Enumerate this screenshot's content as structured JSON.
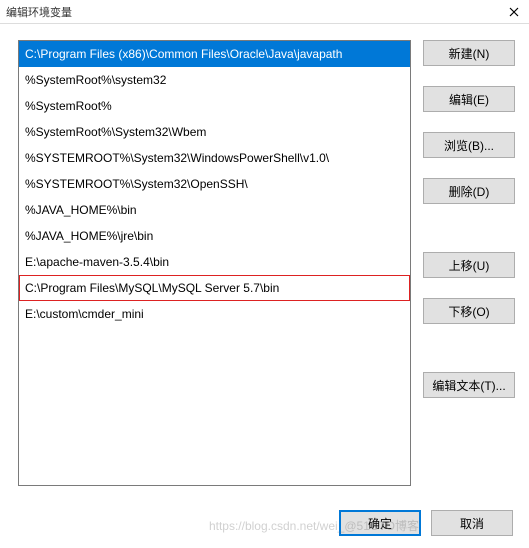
{
  "titlebar": {
    "title": "编辑环境变量"
  },
  "list": {
    "items": [
      {
        "text": "C:\\Program Files (x86)\\Common Files\\Oracle\\Java\\javapath",
        "selected": true,
        "highlighted": false
      },
      {
        "text": "%SystemRoot%\\system32",
        "selected": false,
        "highlighted": false
      },
      {
        "text": "%SystemRoot%",
        "selected": false,
        "highlighted": false
      },
      {
        "text": "%SystemRoot%\\System32\\Wbem",
        "selected": false,
        "highlighted": false
      },
      {
        "text": "%SYSTEMROOT%\\System32\\WindowsPowerShell\\v1.0\\",
        "selected": false,
        "highlighted": false
      },
      {
        "text": "%SYSTEMROOT%\\System32\\OpenSSH\\",
        "selected": false,
        "highlighted": false
      },
      {
        "text": "%JAVA_HOME%\\bin",
        "selected": false,
        "highlighted": false
      },
      {
        "text": "%JAVA_HOME%\\jre\\bin",
        "selected": false,
        "highlighted": false
      },
      {
        "text": "E:\\apache-maven-3.5.4\\bin",
        "selected": false,
        "highlighted": false
      },
      {
        "text": "C:\\Program Files\\MySQL\\MySQL Server 5.7\\bin",
        "selected": false,
        "highlighted": true
      },
      {
        "text": "E:\\custom\\cmder_mini",
        "selected": false,
        "highlighted": false
      }
    ]
  },
  "buttons": {
    "new": "新建(N)",
    "edit": "编辑(E)",
    "browse": "浏览(B)...",
    "delete": "删除(D)",
    "moveup": "上移(U)",
    "movedown": "下移(O)",
    "edittext": "编辑文本(T)...",
    "ok": "确定",
    "cancel": "取消"
  },
  "watermark": "https://blog.csdn.net/wei_@51CTO博客"
}
